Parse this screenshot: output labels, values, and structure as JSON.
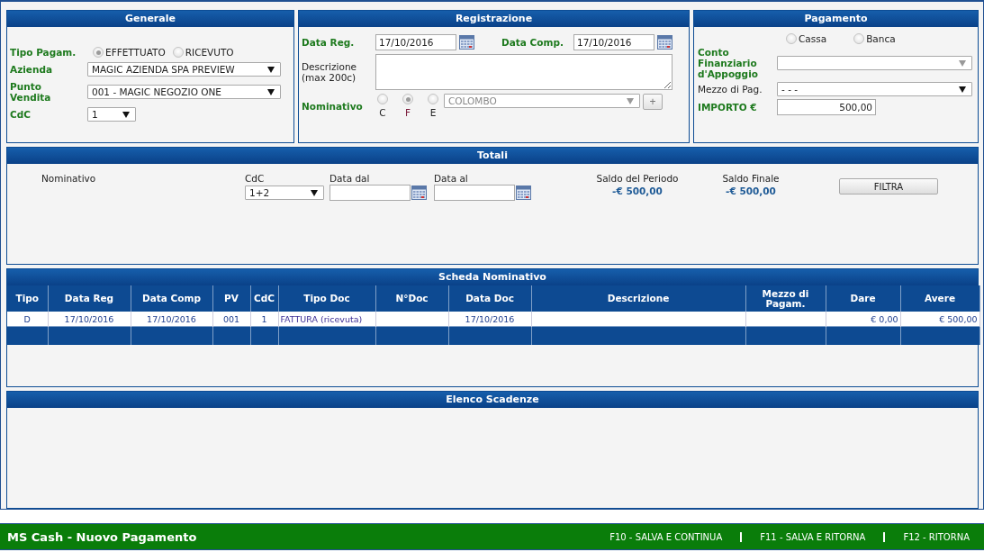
{
  "generale": {
    "title": "Generale",
    "tipo_pagamento": {
      "label": "Tipo Pagam.",
      "options": [
        {
          "label": "EFFETTUATO",
          "selected": true
        },
        {
          "label": "RICEVUTO",
          "selected": false
        }
      ]
    },
    "azienda": {
      "label": "Azienda",
      "value": "MAGIC AZIENDA SPA PREVIEW"
    },
    "punto_vendita": {
      "label": "Punto Vendita",
      "value": "001 - MAGIC NEGOZIO ONE"
    },
    "cdc": {
      "label": "CdC",
      "value": "1"
    }
  },
  "registrazione": {
    "title": "Registrazione",
    "data_reg": {
      "label": "Data Reg.",
      "value": "17/10/2016"
    },
    "data_comp": {
      "label": "Data Comp.",
      "value": "17/10/2016"
    },
    "descrizione": {
      "label": "Descrizione (max 200c)"
    },
    "nominativo": {
      "label": "Nominativo",
      "options": [
        {
          "label": "C",
          "selected": false
        },
        {
          "label": "F",
          "selected": true
        },
        {
          "label": "E",
          "selected": false
        }
      ],
      "value": "COLOMBO",
      "disabled": true,
      "add_button": "+"
    }
  },
  "pagamento": {
    "title": "Pagamento",
    "options": [
      {
        "label": "Cassa",
        "selected": false
      },
      {
        "label": "Banca",
        "selected": false
      }
    ],
    "conto": {
      "label": "Conto Finanziario d'Appoggio"
    },
    "mezzo": {
      "label": "Mezzo di Pag.",
      "value": "- - -"
    },
    "importo": {
      "label": "IMPORTO €",
      "value": "500,00"
    }
  },
  "totali": {
    "title": "Totali",
    "nominativo_label": "Nominativo",
    "cdc": {
      "label": "CdC",
      "value": "1+2"
    },
    "data_dal": {
      "label": "Data dal"
    },
    "data_al": {
      "label": "Data al"
    },
    "saldo_periodo": {
      "label": "Saldo del Periodo",
      "value": "-€ 500,00"
    },
    "saldo_finale": {
      "label": "Saldo Finale",
      "value": "-€ 500,00"
    },
    "button": "FILTRA"
  },
  "scheda": {
    "title": "Scheda Nominativo",
    "columns": [
      "Tipo",
      "Data Reg",
      "Data Comp",
      "PV",
      "CdC",
      "Tipo Doc",
      "N°Doc",
      "Data Doc",
      "Descrizione",
      "Mezzo di Pagam.",
      "Dare",
      "Avere"
    ],
    "rows": [
      [
        "D",
        "17/10/2016",
        "17/10/2016",
        "001",
        "1",
        "FATTURA (ricevuta)",
        "",
        "17/10/2016",
        "",
        "",
        "€ 0,00",
        "€ 500,00"
      ]
    ]
  },
  "scadenze": {
    "title": "Elenco Scadenze"
  },
  "footer": {
    "title": "MS Cash - Nuovo Pagamento",
    "shortcuts": [
      "F10 - SALVA E CONTINUA",
      "F11 - SALVA E RITORNA",
      "F12 - RITORNA"
    ]
  }
}
